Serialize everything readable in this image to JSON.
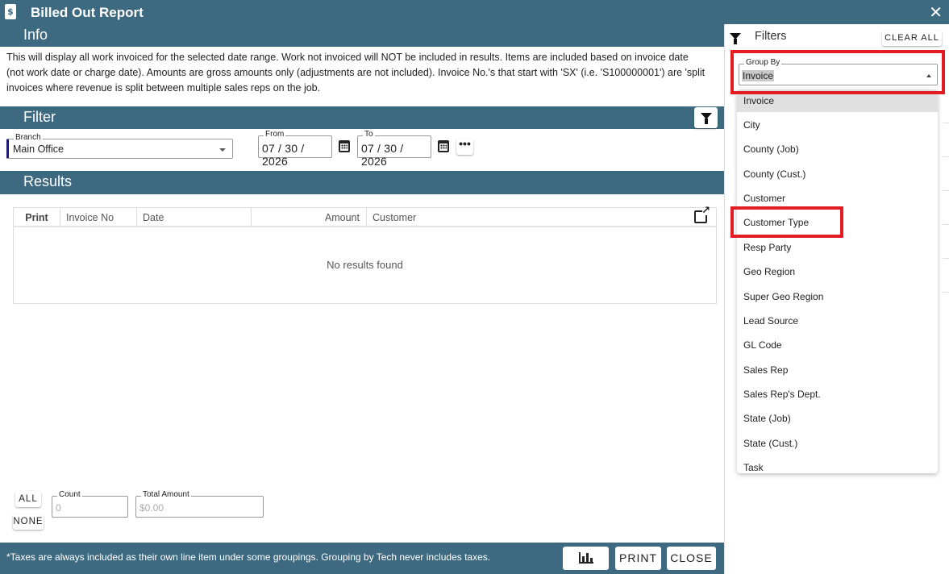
{
  "window": {
    "title": "Billed Out Report",
    "doc_icon_glyph": "$",
    "close_glyph": "✕"
  },
  "info": {
    "heading": "Info",
    "text": "This will display all work invoiced for the selected date range. Work not invoiced will NOT be included in results. Items are included based on invoice date (not work date or charge date). Amounts are gross amounts only (adjustments are not included). Invoice No.'s that start with 'SX' (i.e. 'S100000001') are 'split invoices where revenue is split between multiple sales reps on the job."
  },
  "filter": {
    "heading": "Filter",
    "branch": {
      "label": "Branch",
      "value": "Main Office"
    },
    "from": {
      "label": "From",
      "value": "07 / 30 / 2026"
    },
    "to": {
      "label": "To",
      "value": "07 / 30 / 2026"
    },
    "more_glyph": "•••"
  },
  "results": {
    "heading": "Results",
    "columns": [
      "Print",
      "Invoice No",
      "Date",
      "Amount",
      "Customer"
    ],
    "empty_text": "No results found"
  },
  "totals": {
    "all_label": "ALL",
    "none_label": "NONE",
    "count": {
      "label": "Count",
      "placeholder": "0"
    },
    "total_amount": {
      "label": "Total Amount",
      "placeholder": "$0.00"
    }
  },
  "footer": {
    "note": "*Taxes are always included as their own line item under some groupings. Grouping by Tech never includes taxes.",
    "print_label": "PRINT",
    "close_label": "CLOSE"
  },
  "filters_panel": {
    "title": "Filters",
    "clear_all_label": "CLEAR ALL",
    "group_by": {
      "label": "Group By",
      "value": "Invoice",
      "options": [
        "Invoice",
        "City",
        "County (Job)",
        "County (Cust.)",
        "Customer",
        "Customer Type",
        "Resp Party",
        "Geo Region",
        "Super Geo Region",
        "Lead Source",
        "GL Code",
        "Sales Rep",
        "Sales Rep's Dept.",
        "State (Job)",
        "State (Cust.)",
        "Task"
      ],
      "selected_index": 0
    }
  },
  "colors": {
    "header_bar": "#3d6a80",
    "highlight": "#e31b23",
    "selected_option_bg": "#e0e0e0"
  }
}
